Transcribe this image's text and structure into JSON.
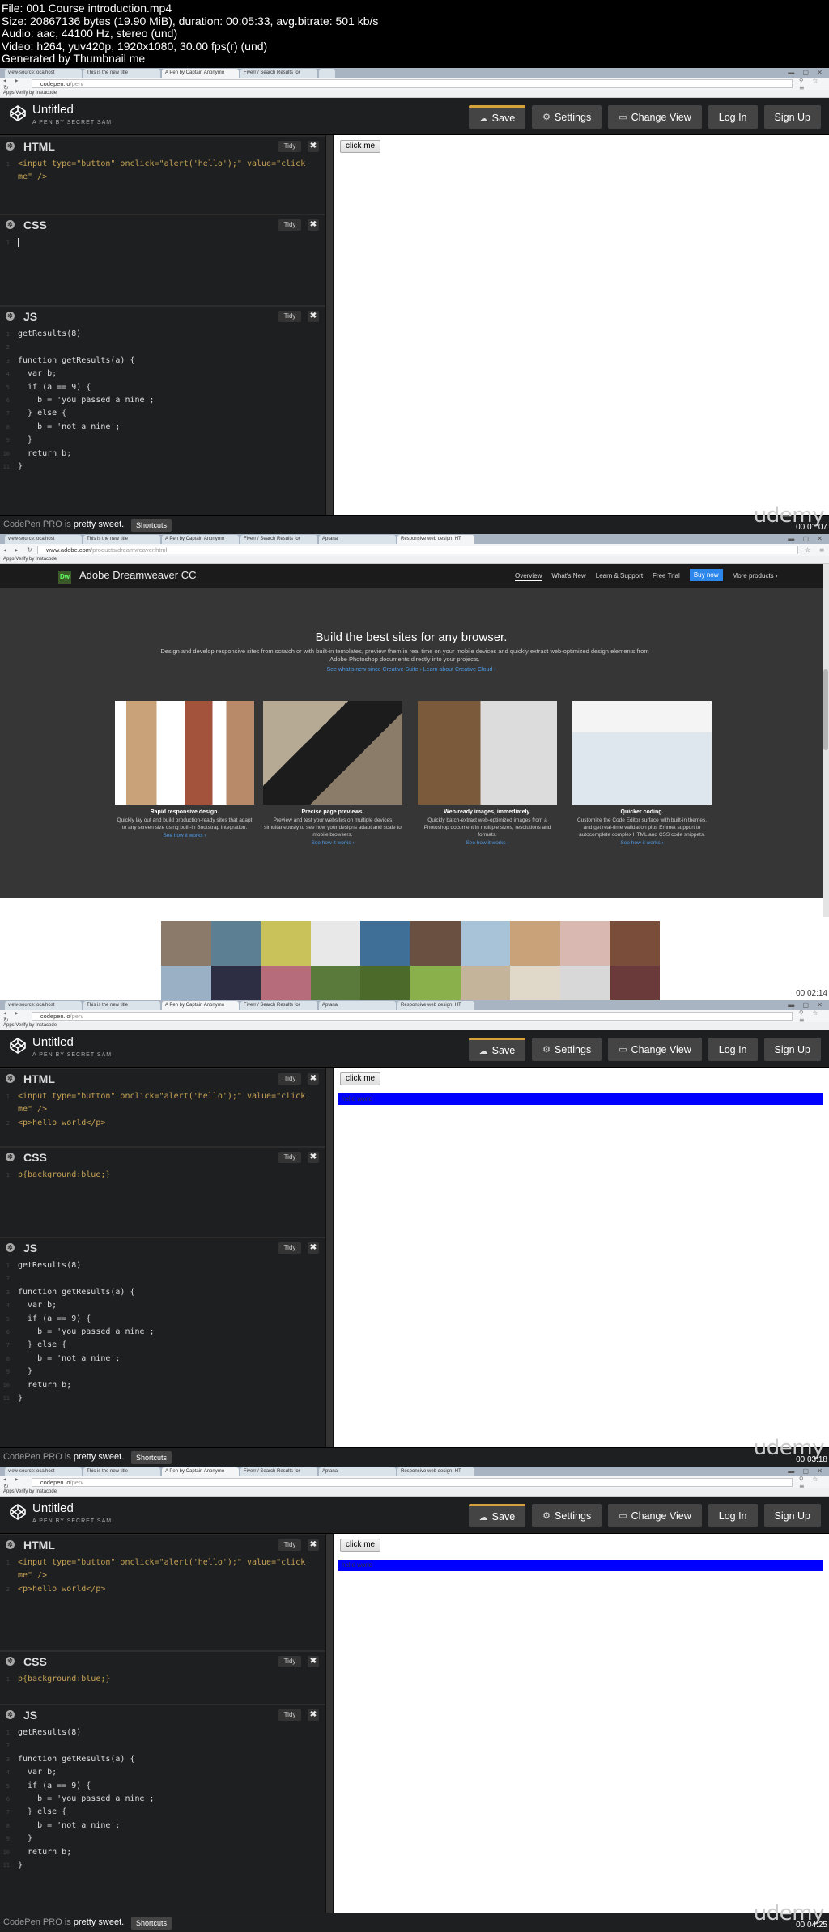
{
  "video_info": [
    "File: 001 Course introduction.mp4",
    "Size: 20867136 bytes (19.90 MiB), duration: 00:05:33, avg.bitrate: 501 kb/s",
    "Audio: aac, 44100 Hz, stereo (und)",
    "Video: h264, yuv420p, 1920x1080, 30.00 fps(r) (und)",
    "Generated by Thumbnail me"
  ],
  "timestamps": [
    "00:01:07",
    "00:02:14",
    "00:03:18",
    "00:04:25"
  ],
  "watermark": "udemy",
  "browser": {
    "tabs_codepen": [
      "view-source:localhost",
      "This is the new title",
      "A Pen by Captain Anonymo",
      "Fiverr / Search Results for",
      ""
    ],
    "tabs_adobe": [
      "view-source:localhost",
      "This is the new title",
      "A Pen by Captain Anonymo",
      "Fiverr / Search Results for",
      "Aptana",
      "Responsive web design, HT"
    ],
    "url_codepen_host": "codepen.io",
    "url_codepen_path": "/pen/",
    "url_adobe_host": "www.adobe.com",
    "url_adobe_path": "/products/dreamweaver.html",
    "bookmarks": "Apps   Verify by Instacode"
  },
  "codepen": {
    "title": "Untitled",
    "subtitle": "A PEN BY SECRET SAM",
    "buttons": {
      "save": "Save",
      "settings": "Settings",
      "change_view": "Change View",
      "login": "Log In",
      "signup": "Sign Up"
    },
    "panels": {
      "html": "HTML",
      "css": "CSS",
      "js": "JS",
      "tidy": "Tidy",
      "close": "✖"
    },
    "preview_button": "click me",
    "preview_para": "hello world",
    "footer_text_1": "CodePen PRO",
    "footer_text_2": " is ",
    "footer_text_3": "pretty sweet.",
    "footer_shortcuts": "Shortcuts",
    "html_line1": "<input type=\"button\" onclick=\"alert('hello');\" value=\"click",
    "html_line2": "me\" />",
    "html_line3": "<p>hello world</p>",
    "css_line": "p{background:blue;}",
    "js_lines": [
      "getResults(8)",
      "",
      "function getResults(a) {",
      "  var b;",
      "  if (a == 9) {",
      "    b = 'you passed a nine';",
      "  } else {",
      "    b = 'not a nine';",
      "  }",
      "  return b;",
      "}"
    ]
  },
  "adobe": {
    "product": "Adobe Dreamweaver CC",
    "nav": [
      "Overview",
      "What's New",
      "Learn & Support",
      "Free Trial",
      "Buy now",
      "More products ›"
    ],
    "headline": "Build the best sites for any browser.",
    "lead": "Design and develop responsive sites from scratch or with built-in templates, preview them in real time on your mobile devices and quickly extract web-optimized design elements from Adobe Photoshop documents directly into your projects.",
    "links": "See what's new since Creative Suite ›     Learn about Creative Cloud ›",
    "cards": [
      {
        "title": "Rapid responsive design.",
        "desc": "Quickly lay out and build production-ready sites that adapt to any screen size using built-in Bootstrap integration.",
        "link": "See how it works ›"
      },
      {
        "title": "Precise page previews.",
        "desc": "Preview and test your websites on multiple devices simultaneously to see how your designs adapt and scale to mobile browsers.",
        "link": "See how it works ›"
      },
      {
        "title": "Web-ready images, immediately.",
        "desc": "Quickly batch-extract web-optimized images from a Photoshop document in multiple sizes, resolutions and formats.",
        "link": "See how it works ›"
      },
      {
        "title": "Quicker coding.",
        "desc": "Customize the Code Editor surface with built-in themes, and get real-time validation plus Emmet support to autocomplete complex HTML and CSS code snippets.",
        "link": "See how it works ›"
      }
    ]
  },
  "colors": {
    "accent_save": "#d6a33a",
    "preview_blue": "#0000ff",
    "adobe_buy": "#2d87ea"
  }
}
